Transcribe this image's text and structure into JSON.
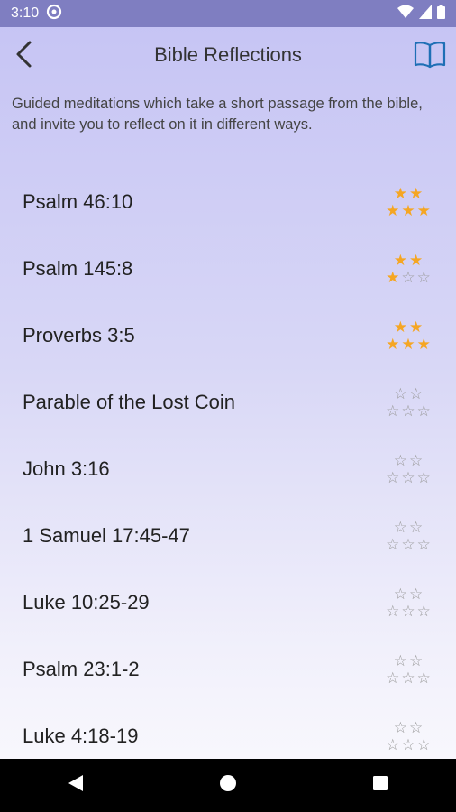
{
  "status_bar": {
    "time": "3:10"
  },
  "app_bar": {
    "title": "Bible Reflections"
  },
  "description": "Guided meditations which take a short passage from the bible, and invite you to reflect on it in different ways.",
  "rating_max": 5,
  "colors": {
    "accent_star": "#f5a623",
    "status_bar": "#7f7ec1",
    "nav_bar": "#000000"
  },
  "items": [
    {
      "title": "Psalm 46:10",
      "rating": 5
    },
    {
      "title": "Psalm 145:8",
      "rating": 3
    },
    {
      "title": "Proverbs 3:5",
      "rating": 5
    },
    {
      "title": "Parable of the Lost Coin",
      "rating": 0
    },
    {
      "title": "John 3:16",
      "rating": 0
    },
    {
      "title": "1 Samuel 17:45-47",
      "rating": 0
    },
    {
      "title": "Luke 10:25-29",
      "rating": 0
    },
    {
      "title": "Psalm 23:1-2",
      "rating": 0
    },
    {
      "title": "Luke 4:18-19",
      "rating": 0
    }
  ],
  "icons": {
    "back": "back-arrow-icon",
    "book": "book-icon",
    "nav_back": "nav-back-icon",
    "nav_home": "nav-home-icon",
    "nav_recents": "nav-recents-icon"
  }
}
